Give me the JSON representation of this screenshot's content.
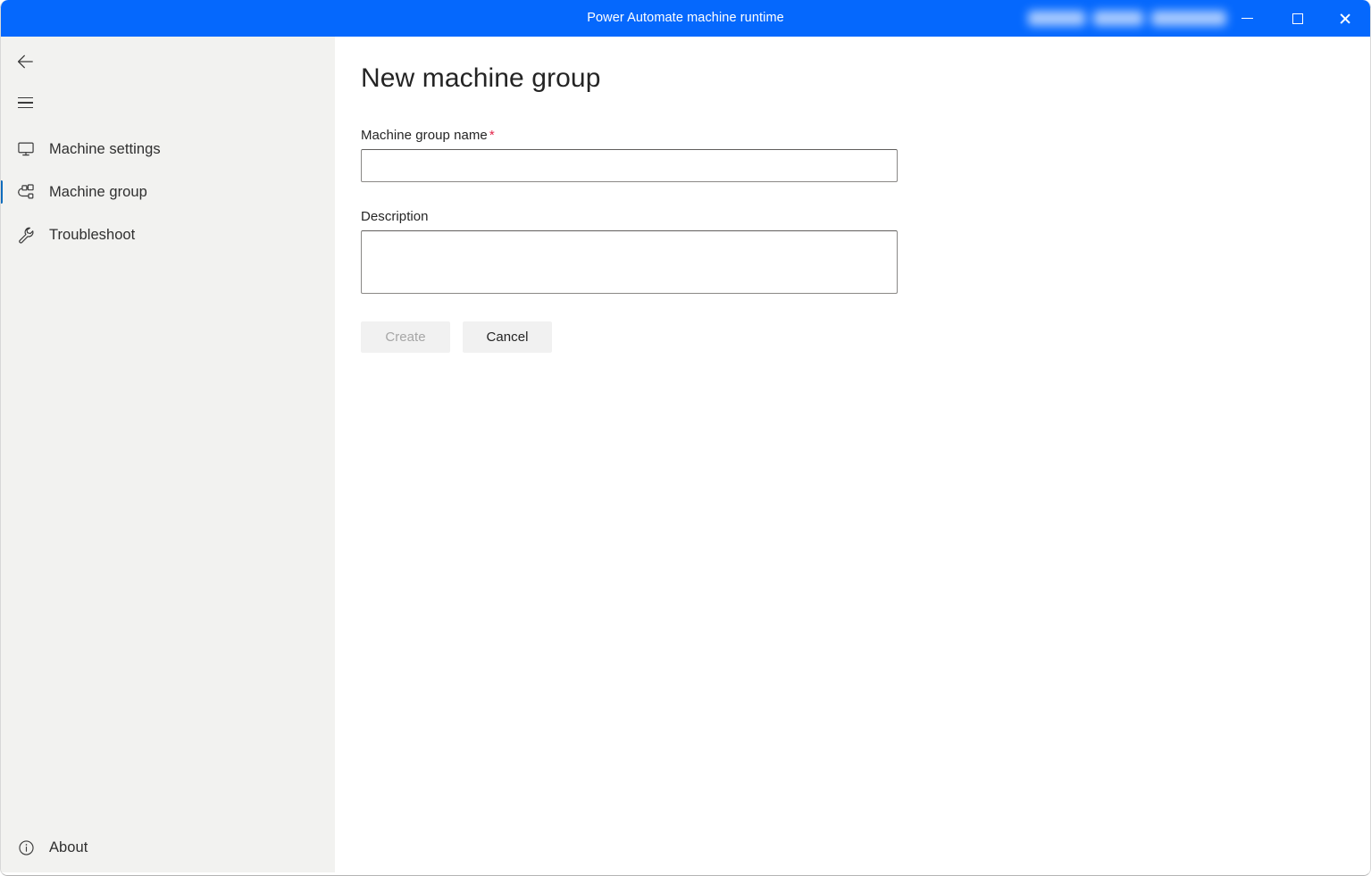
{
  "window": {
    "title": "Power Automate machine runtime",
    "accent_color": "#0568fd",
    "sidebar_color": "#f2f2f0",
    "selection_accent": "#0f6cbd",
    "required_color": "#e3254a",
    "account_chip_redacted": true,
    "controls": {
      "minimize": "Minimize",
      "maximize": "Maximize",
      "close": "Close"
    }
  },
  "sidebar": {
    "back_label": "Back",
    "menu_label": "Navigation menu",
    "items": [
      {
        "label": "Machine settings",
        "icon": "monitor-icon",
        "selected": false
      },
      {
        "label": "Machine group",
        "icon": "machine-group-icon",
        "selected": true
      },
      {
        "label": "Troubleshoot",
        "icon": "wrench-icon",
        "selected": false
      }
    ],
    "about": {
      "label": "About",
      "icon": "info-circle-icon"
    }
  },
  "main": {
    "page_title": "New machine group",
    "fields": [
      {
        "label": "Machine group name",
        "required": true,
        "required_marker": "*",
        "value": "",
        "placeholder": "",
        "type": "text"
      },
      {
        "label": "Description",
        "required": false,
        "required_marker": "",
        "value": "",
        "placeholder": "",
        "type": "textarea"
      }
    ],
    "buttons": {
      "create": {
        "label": "Create",
        "enabled": false
      },
      "cancel": {
        "label": "Cancel",
        "enabled": true
      }
    }
  }
}
